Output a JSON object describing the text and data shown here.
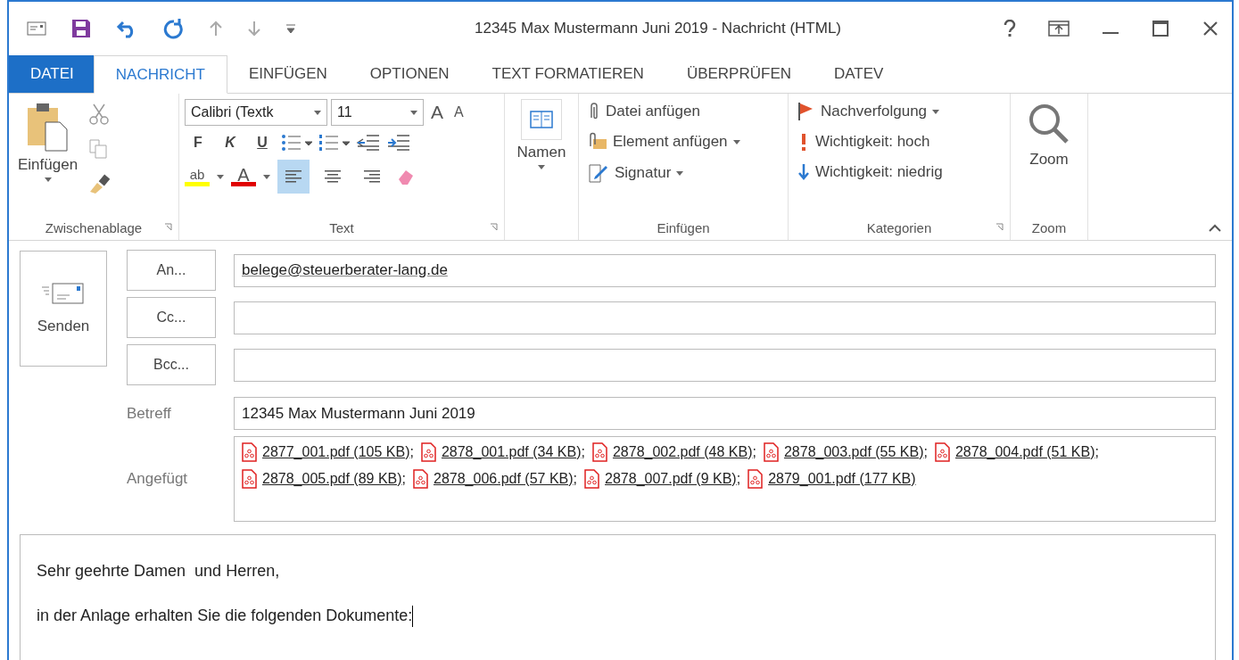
{
  "window": {
    "title": "12345 Max Mustermann Juni 2019 - Nachricht (HTML)"
  },
  "tabs": [
    {
      "label": "DATEI",
      "kind": "file",
      "selected": false
    },
    {
      "label": "NACHRICHT",
      "kind": "tab",
      "selected": true
    },
    {
      "label": "EINFÜGEN",
      "kind": "tab",
      "selected": false
    },
    {
      "label": "OPTIONEN",
      "kind": "tab",
      "selected": false
    },
    {
      "label": "TEXT FORMATIEREN",
      "kind": "tab",
      "selected": false
    },
    {
      "label": "ÜBERPRÜFEN",
      "kind": "tab",
      "selected": false
    },
    {
      "label": "DATEV",
      "kind": "tab",
      "selected": false
    }
  ],
  "ribbon": {
    "clipboard": {
      "paste": "Einfügen",
      "group": "Zwischenablage"
    },
    "text": {
      "font": "Calibri (Textk",
      "size": "11",
      "grow": "A",
      "shrink": "A",
      "bold": "F",
      "italic": "K",
      "underline": "U",
      "highlight": "ab",
      "font_color": "A",
      "group": "Text",
      "alignments": [
        {
          "kind": "left",
          "selected": true
        },
        {
          "kind": "center",
          "selected": false
        },
        {
          "kind": "right",
          "selected": false
        }
      ]
    },
    "names": {
      "label": "Namen"
    },
    "insert": {
      "group": "Einfügen",
      "items": [
        {
          "label": "Datei anfügen",
          "kind": "clip",
          "dropdown": false
        },
        {
          "label": "Element anfügen",
          "kind": "item",
          "dropdown": true
        },
        {
          "label": "Signatur",
          "kind": "sign",
          "dropdown": true
        }
      ]
    },
    "categories": {
      "group": "Kategorien",
      "items": [
        {
          "label": "Nachverfolgung",
          "kind": "flag",
          "dropdown": true
        },
        {
          "label": "Wichtigkeit: hoch",
          "kind": "high",
          "dropdown": false
        },
        {
          "label": "Wichtigkeit: niedrig",
          "kind": "low",
          "dropdown": false
        }
      ]
    },
    "zoom": {
      "label": "Zoom",
      "group": "Zoom"
    }
  },
  "compose": {
    "send": "Senden",
    "recipients": [
      {
        "button": "An...",
        "value": "belege@steuerberater-lang.de"
      },
      {
        "button": "Cc..."
      },
      {
        "button": "Bcc..."
      }
    ],
    "subject_label": "Betreff",
    "subject": "12345 Max Mustermann Juni 2019",
    "attachments_label": "Angefügt",
    "attachments": [
      {
        "name": "2877_001.pdf (105 KB)",
        "separator": ";"
      },
      {
        "name": "2878_001.pdf (34 KB)",
        "separator": ";"
      },
      {
        "name": "2878_002.pdf (48 KB)",
        "separator": ";"
      },
      {
        "name": "2878_003.pdf (55 KB)",
        "separator": ";"
      },
      {
        "name": "2878_004.pdf (51 KB)",
        "separator": ";"
      },
      {
        "name": "2878_005.pdf (89 KB)",
        "separator": ";"
      },
      {
        "name": "2878_006.pdf (57 KB)",
        "separator": ";"
      },
      {
        "name": "2878_007.pdf (9 KB)",
        "separator": ";"
      },
      {
        "name": "2879_001.pdf (177 KB)"
      }
    ],
    "body": [
      "Sehr geehrte Damen  und Herren,",
      "in der Anlage erhalten Sie die folgenden Dokumente:"
    ]
  }
}
